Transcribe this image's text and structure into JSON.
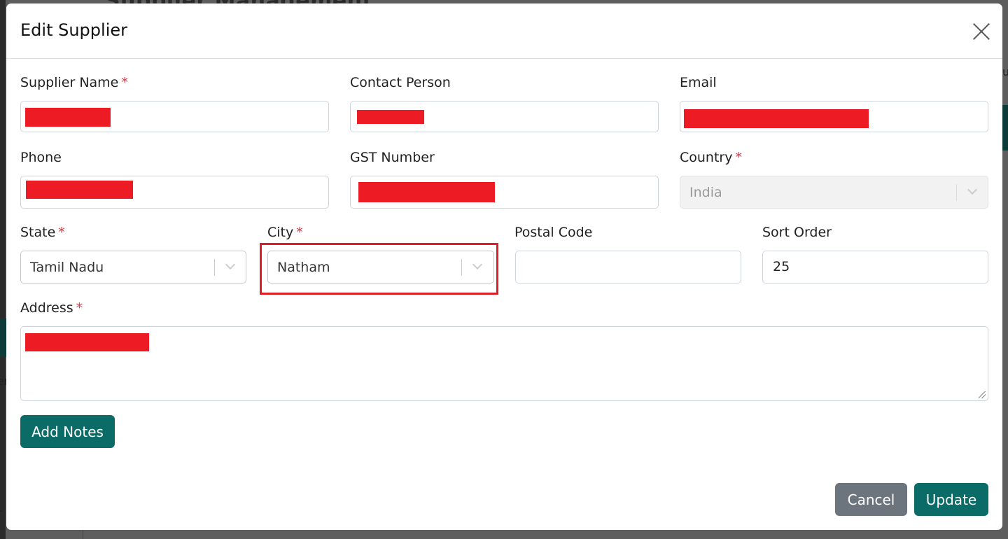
{
  "background": {
    "page_title": "Supplier Management",
    "fragment_right": "u",
    "fragment_left_1": "er",
    "fragment_left_2": "r"
  },
  "modal": {
    "title": "Edit Supplier",
    "close_icon": "close-icon"
  },
  "fields": {
    "supplier_name": {
      "label": "Supplier Name",
      "required": "*",
      "value": ""
    },
    "contact_person": {
      "label": "Contact Person",
      "value": ""
    },
    "email": {
      "label": "Email",
      "value": ""
    },
    "phone": {
      "label": "Phone",
      "value": ""
    },
    "gst_number": {
      "label": "GST Number",
      "value": ""
    },
    "country": {
      "label": "Country",
      "required": "*",
      "value": "India",
      "disabled": true
    },
    "state": {
      "label": "State",
      "required": "*",
      "value": "Tamil Nadu"
    },
    "city": {
      "label": "City",
      "required": "*",
      "value": "Natham"
    },
    "postal_code": {
      "label": "Postal Code",
      "value": ""
    },
    "sort_order": {
      "label": "Sort Order",
      "value": "25"
    },
    "address": {
      "label": "Address",
      "required": "*",
      "value": ""
    }
  },
  "buttons": {
    "add_notes": "Add Notes",
    "cancel": "Cancel",
    "update": "Update"
  },
  "colors": {
    "primary": "#0b6b67",
    "secondary": "#6c757d",
    "required": "#dc3545",
    "highlight": "#dc1f26",
    "redaction": "#ed1c24"
  }
}
